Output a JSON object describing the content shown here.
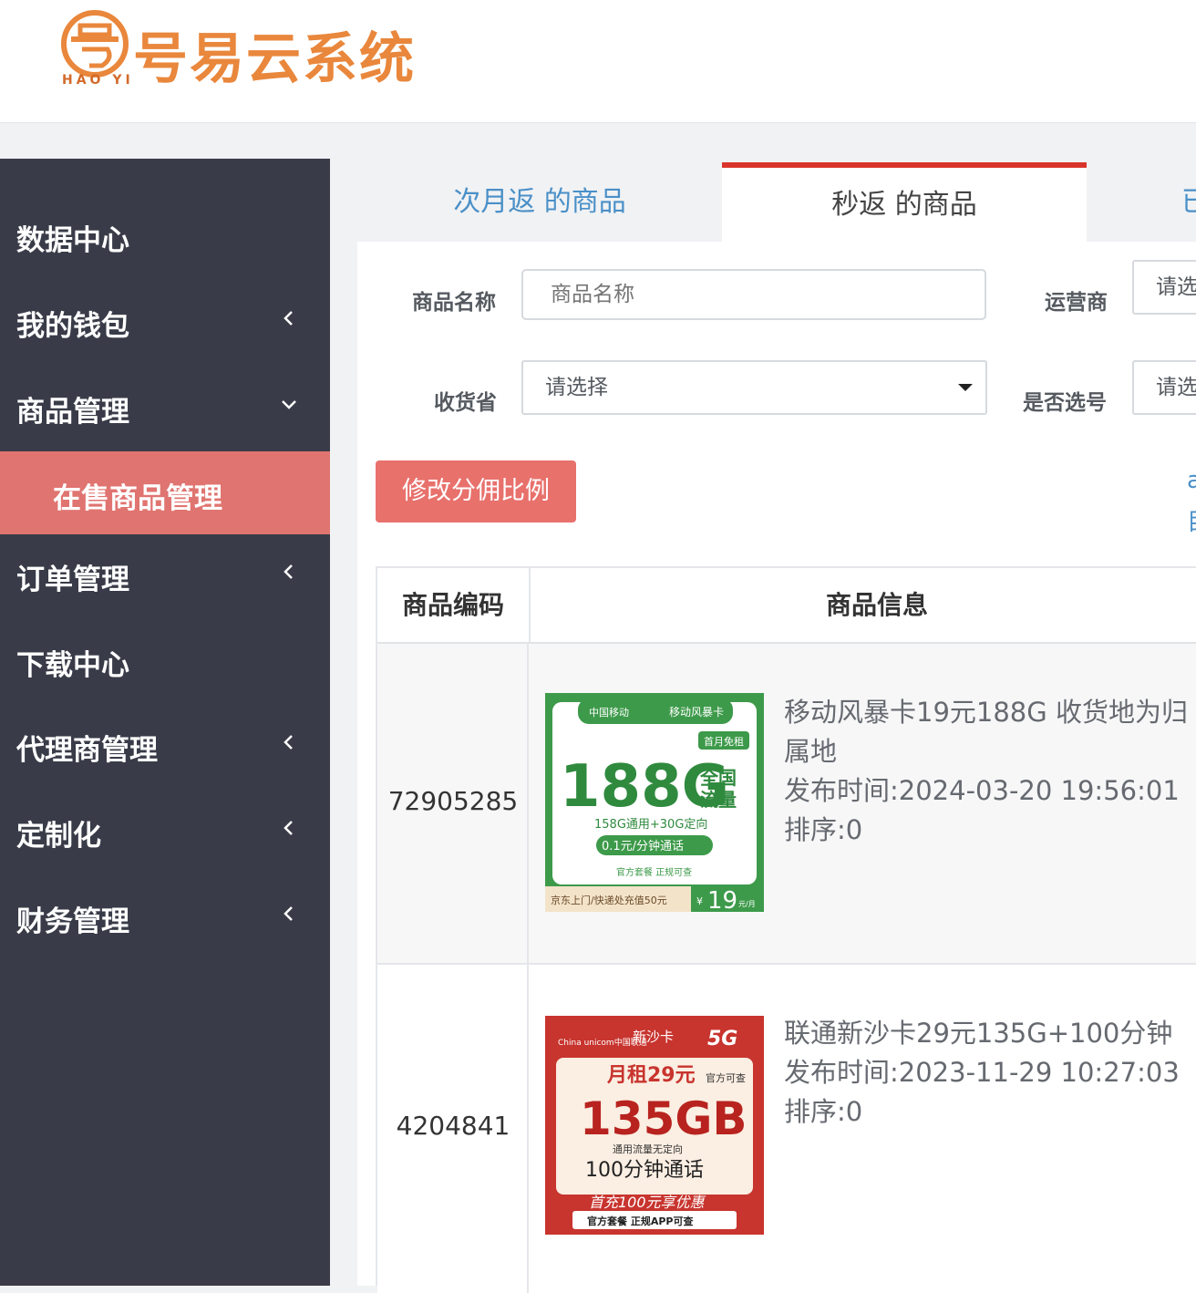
{
  "brand": {
    "name": "号易云系统",
    "sub": "HAO YI"
  },
  "sidebar": {
    "items": [
      {
        "label": "数据中心",
        "chevron": "none"
      },
      {
        "label": "我的钱包",
        "chevron": "left"
      },
      {
        "label": "商品管理",
        "chevron": "down"
      },
      {
        "label": "订单管理",
        "chevron": "left"
      },
      {
        "label": "下载中心",
        "chevron": "none"
      },
      {
        "label": "代理商管理",
        "chevron": "left"
      },
      {
        "label": "定制化",
        "chevron": "left"
      },
      {
        "label": "财务管理",
        "chevron": "left"
      }
    ],
    "active_sub": "在售商品管理"
  },
  "tabs": [
    {
      "label": "次月返 的商品",
      "active": false
    },
    {
      "label": "秒返 的商品",
      "active": true
    },
    {
      "label": "已",
      "active": false
    }
  ],
  "filters": {
    "name_label": "商品名称",
    "name_placeholder": "商品名称",
    "operator_label": "运营商",
    "operator_value": "请选",
    "province_label": "收货省",
    "province_value": "请选择",
    "pick_label": "是否选号",
    "pick_value": "请选"
  },
  "actions": {
    "edit_commission": "修改分佣比例"
  },
  "edge_links": [
    "a",
    "目"
  ],
  "table": {
    "headers": {
      "code": "商品编码",
      "info": "商品信息"
    },
    "rows": [
      {
        "code": "72905285",
        "title": "移动风暴卡19元188G 收货地为归属地",
        "publish": "发布时间:2024-03-20 19:56:01",
        "sort": "排序:0",
        "image": {
          "brand": "中国移动",
          "card": "移动风暴卡",
          "badge": "首月免租",
          "big": "188G",
          "side": "全国流量",
          "sub": "158G通用+30G定向",
          "pill": "0.1元/分钟通话",
          "note": "官方套餐 正规可查",
          "foot": "京东上门/快递处充值50元",
          "price": "19",
          "unit": "元/月"
        }
      },
      {
        "code": "4204841",
        "title": "联通新沙卡29元135G+100分钟",
        "publish": "发布时间:2023-11-29 10:27:03",
        "sort": "排序:0",
        "image": {
          "brand": "China unicom中国联通",
          "card": "新沙卡",
          "tag": "5G",
          "rent": "月租29元",
          "check": "官方可查",
          "big": "135GB",
          "sub": "通用流量无定向",
          "mins": "100分钟通话",
          "promo": "首充100元享优惠",
          "foot": "官方套餐 正规APP可查"
        }
      }
    ]
  },
  "colors": {
    "sidebar": "#393c48",
    "active_sub": "#e07470",
    "tab_accent": "#d9342b",
    "link": "#4a90c8",
    "logo": "#e9873c"
  }
}
